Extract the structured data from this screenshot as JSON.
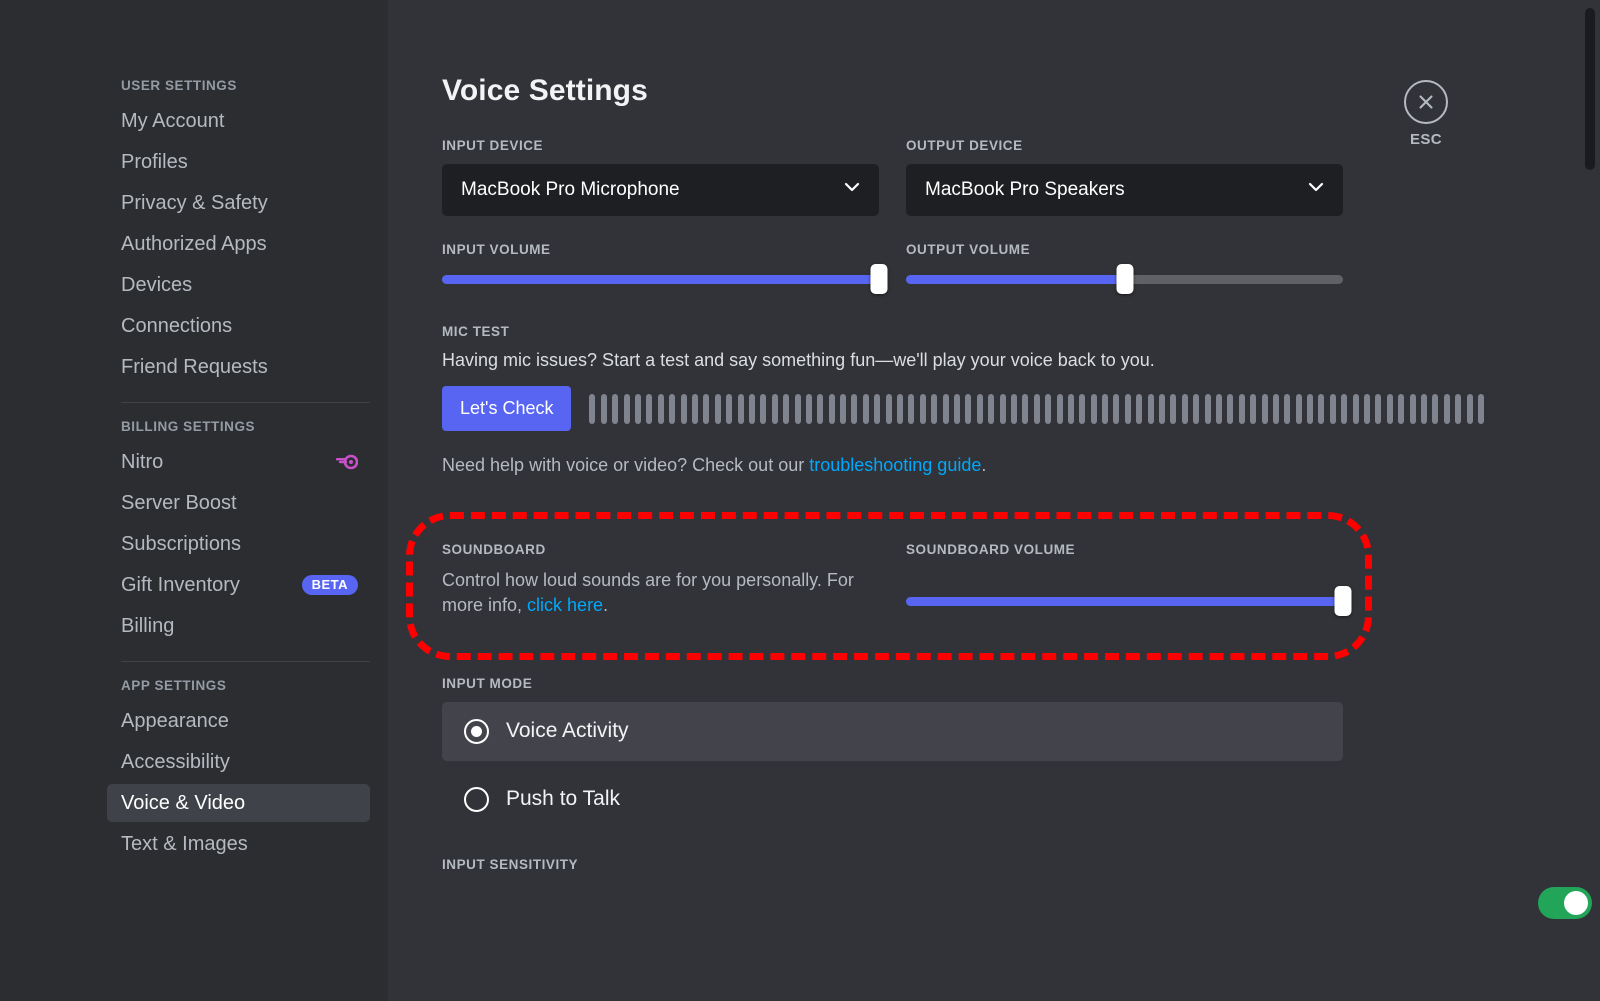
{
  "window": {
    "accent_blurple": "#5865f2",
    "link_blue": "#00a8fc",
    "highlight_red": "#ff0000",
    "toggle_green": "#23a559"
  },
  "sidebar": {
    "sections": [
      {
        "header": "USER SETTINGS",
        "items": [
          {
            "label": "My Account",
            "badge": null,
            "icon": null,
            "active": false
          },
          {
            "label": "Profiles",
            "badge": null,
            "icon": null,
            "active": false
          },
          {
            "label": "Privacy & Safety",
            "badge": null,
            "icon": null,
            "active": false
          },
          {
            "label": "Authorized Apps",
            "badge": null,
            "icon": null,
            "active": false
          },
          {
            "label": "Devices",
            "badge": null,
            "icon": null,
            "active": false
          },
          {
            "label": "Connections",
            "badge": null,
            "icon": null,
            "active": false
          },
          {
            "label": "Friend Requests",
            "badge": null,
            "icon": null,
            "active": false
          }
        ]
      },
      {
        "header": "BILLING SETTINGS",
        "items": [
          {
            "label": "Nitro",
            "badge": null,
            "icon": "nitro-icon",
            "active": false
          },
          {
            "label": "Server Boost",
            "badge": null,
            "icon": null,
            "active": false
          },
          {
            "label": "Subscriptions",
            "badge": null,
            "icon": null,
            "active": false
          },
          {
            "label": "Gift Inventory",
            "badge": "BETA",
            "icon": null,
            "active": false
          },
          {
            "label": "Billing",
            "badge": null,
            "icon": null,
            "active": false
          }
        ]
      },
      {
        "header": "APP SETTINGS",
        "items": [
          {
            "label": "Appearance",
            "badge": null,
            "icon": null,
            "active": false
          },
          {
            "label": "Accessibility",
            "badge": null,
            "icon": null,
            "active": false
          },
          {
            "label": "Voice & Video",
            "badge": null,
            "icon": null,
            "active": true
          },
          {
            "label": "Text & Images",
            "badge": null,
            "icon": null,
            "active": false
          }
        ]
      }
    ]
  },
  "main": {
    "title": "Voice Settings",
    "input_device": {
      "label": "INPUT DEVICE",
      "value": "MacBook Pro Microphone"
    },
    "output_device": {
      "label": "OUTPUT DEVICE",
      "value": "MacBook Pro Speakers"
    },
    "input_volume": {
      "label": "INPUT VOLUME",
      "percent": 100
    },
    "output_volume": {
      "label": "OUTPUT VOLUME",
      "percent": 50
    },
    "mic_test": {
      "label": "MIC TEST",
      "description": "Having mic issues? Start a test and say something fun—we'll play your voice back to you.",
      "button_label": "Let's Check",
      "meter_bar_count": 79
    },
    "help_note": {
      "prefix": "Need help with voice or video? Check out our ",
      "link_label": "troubleshooting guide",
      "suffix": "."
    },
    "soundboard": {
      "label": "SOUNDBOARD",
      "description_prefix": "Control how loud sounds are for you personally. For more info, ",
      "link_label": "click here",
      "description_suffix": ".",
      "volume_label": "SOUNDBOARD VOLUME",
      "volume_percent": 100,
      "highlighted": true
    },
    "input_mode": {
      "label": "INPUT MODE",
      "options": [
        {
          "label": "Voice Activity",
          "selected": true
        },
        {
          "label": "Push to Talk",
          "selected": false
        }
      ]
    },
    "input_sensitivity": {
      "label": "INPUT SENSITIVITY",
      "toggle_on": true
    },
    "close_button": {
      "label": "ESC",
      "icon": "close-icon"
    }
  }
}
